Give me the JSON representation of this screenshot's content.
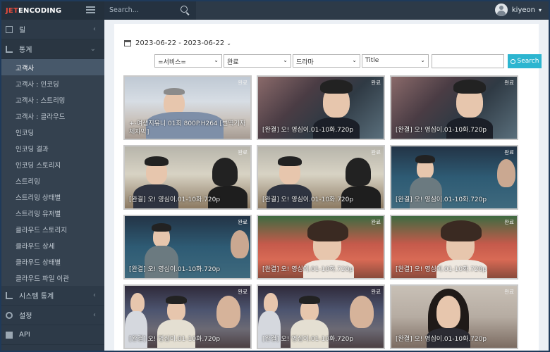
{
  "brand": {
    "part1": "JET",
    "part2": "ENCODING"
  },
  "topbar": {
    "search_placeholder": "Search...",
    "username": "kiyeon"
  },
  "sidebar": {
    "menus": [
      {
        "label": "릴"
      },
      {
        "label": "통계"
      }
    ],
    "submenu": [
      {
        "label": "고객사",
        "active": true
      },
      {
        "label": "고객사 : 인코딩"
      },
      {
        "label": "고객사 : 스트리밍"
      },
      {
        "label": "고객사 : 클라우드"
      },
      {
        "label": "인코딩"
      },
      {
        "label": "인코딩 결과"
      },
      {
        "label": "인코딩 스토리지"
      },
      {
        "label": "스트리밍"
      },
      {
        "label": "스트리밍 상태별"
      },
      {
        "label": "스트리밍 유저별"
      },
      {
        "label": "클라우드 스토리지"
      },
      {
        "label": "클라우드 상세"
      },
      {
        "label": "클라우드 상태별"
      },
      {
        "label": "클라우드 파일 이관"
      }
    ],
    "bottom_menus": [
      {
        "label": "시스템 통계"
      },
      {
        "label": "설정"
      },
      {
        "label": "API"
      }
    ]
  },
  "filters": {
    "date_range": "2023-06-22 - 2023-06-22",
    "service": "=서비스=",
    "status": "완료",
    "genre": "드라마",
    "field": "Title",
    "query": "",
    "search_label": "Search"
  },
  "items": [
    {
      "title": "+-여생지유니 01회 800P.H264 [번역기자체자막]",
      "status": "완료"
    },
    {
      "title": "[완결] 오! 영심이.01-10화.720p",
      "status": "완료"
    },
    {
      "title": "[완결] 오! 영심이.01-10화.720p",
      "status": "완료"
    },
    {
      "title": "[완결] 오! 영심이.01-10화.720p",
      "status": "완료"
    },
    {
      "title": "[완결] 오! 영심이.01-10화.720p",
      "status": "완료"
    },
    {
      "title": "[완결] 오! 영심이.01-10화.720p",
      "status": "완료"
    },
    {
      "title": "[완결] 오! 영심이.01-10화.720p",
      "status": "완료"
    },
    {
      "title": "[완결] 오! 영심이.01-10화.720p",
      "status": "완료"
    },
    {
      "title": "[완결] 오! 영심이.01-10화.720p",
      "status": "완료"
    },
    {
      "title": "[완결] 오! 영심이.01-10화.720p",
      "status": "완료"
    },
    {
      "title": "[완결] 오! 영심이.01-10화.720p",
      "status": "완료"
    },
    {
      "title": "[완결] 오! 영심이.01-10화.720p",
      "status": "완료"
    }
  ]
}
